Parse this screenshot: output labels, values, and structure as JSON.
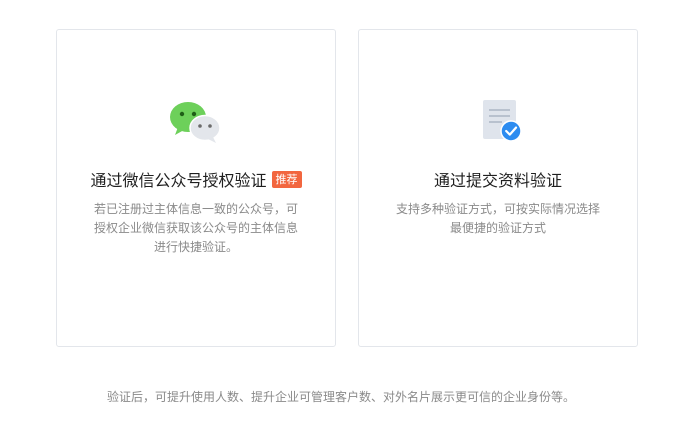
{
  "cards": [
    {
      "icon": "wechat-icon",
      "title": "通过微信公众号授权验证",
      "badge": "推荐",
      "badge_color": "#f2663f",
      "desc_lines": [
        "若已注册过主体信息一致的公众号，可",
        "授权企业微信获取该公众号的主体信息",
        "进行快捷验证。"
      ]
    },
    {
      "icon": "document-verified-icon",
      "title": "通过提交资料验证",
      "desc_lines": [
        "支持多种验证方式，可按实际情况选择",
        "最便捷的验证方式"
      ]
    }
  ],
  "footer_note": "验证后，可提升使用人数、提升企业可管理客户数、对外名片展示更可信的企业身份等。",
  "colors": {
    "wechat_green": "#6dd05a",
    "check_blue": "#2d8cf0",
    "text_primary": "#1f1f1f",
    "text_secondary": "#8a8a8a",
    "card_border": "#e3e6eb"
  }
}
